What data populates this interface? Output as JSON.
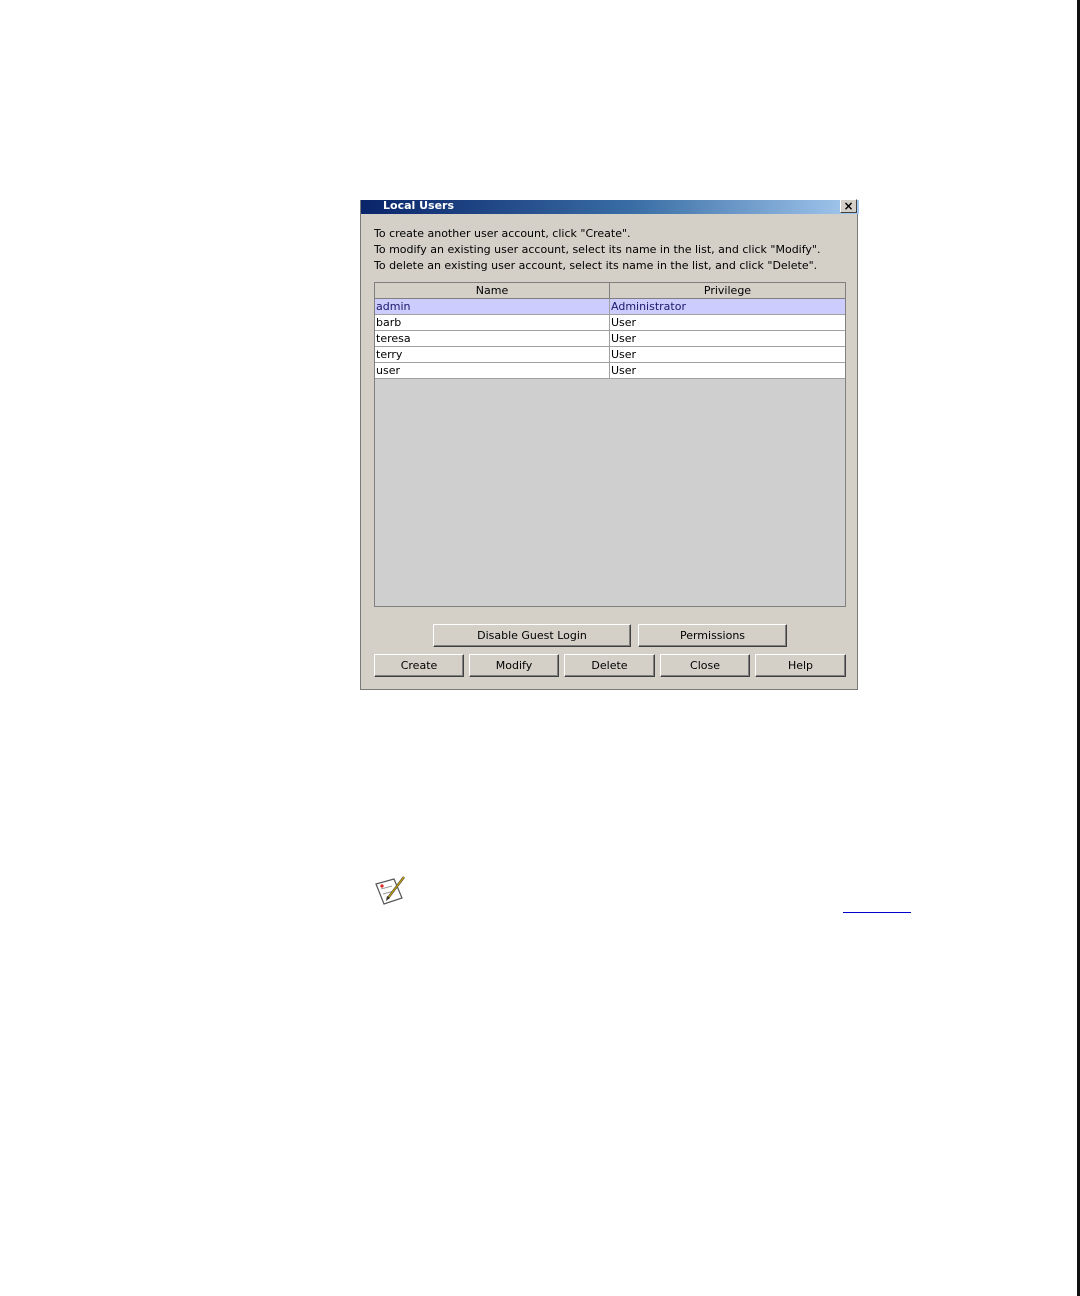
{
  "dialog": {
    "title": "Local Users",
    "close_glyph": "×",
    "instructions": [
      "To create another user account, click \"Create\".",
      "To modify an existing user account, select its name in the list, and click \"Modify\".",
      "To delete an existing user account, select its name in the list, and click \"Delete\"."
    ],
    "table": {
      "columns": [
        "Name",
        "Privilege"
      ],
      "rows": [
        {
          "name": "admin",
          "privilege": "Administrator",
          "selected": true
        },
        {
          "name": "barb",
          "privilege": "User",
          "selected": false
        },
        {
          "name": "teresa",
          "privilege": "User",
          "selected": false
        },
        {
          "name": "terry",
          "privilege": "User",
          "selected": false
        },
        {
          "name": "user",
          "privilege": "User",
          "selected": false
        }
      ]
    },
    "buttons": {
      "disable_guest_login": "Disable Guest Login",
      "permissions": "Permissions",
      "create": "Create",
      "modify": "Modify",
      "delete": "Delete",
      "close": "Close",
      "help": "Help"
    }
  },
  "page": {
    "note_icon": "note-pencil-icon",
    "link_text": ""
  },
  "colors": {
    "titlebar_start": "#0a246a",
    "titlebar_end": "#a6caf0",
    "dialog_bg": "#d4d0c8",
    "selected_row": "#ccccff",
    "link": "#0000cc"
  }
}
